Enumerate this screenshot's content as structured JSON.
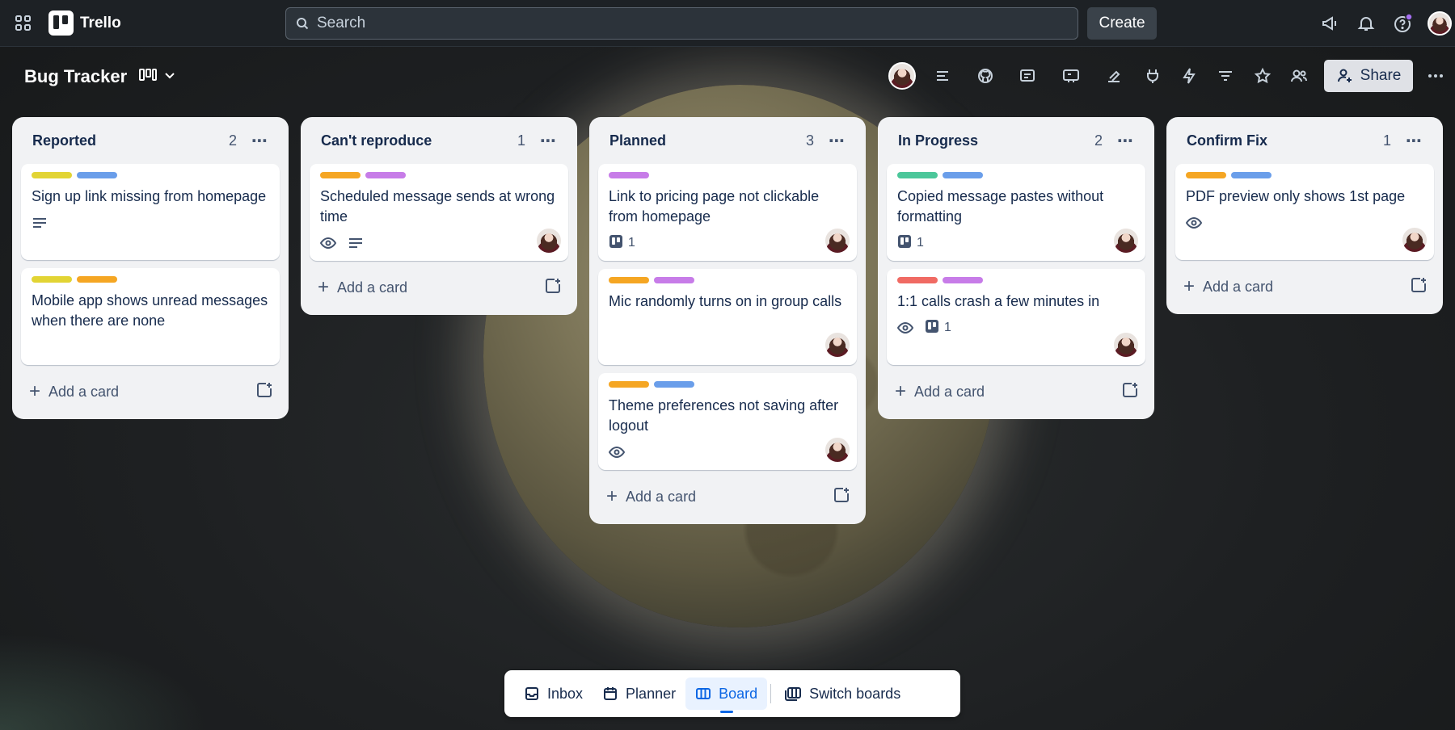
{
  "app": {
    "name": "Trello"
  },
  "search": {
    "placeholder": "Search"
  },
  "topbar": {
    "create_label": "Create"
  },
  "board": {
    "title": "Bug Tracker",
    "share_label": "Share"
  },
  "colors": {
    "yellow": "#e2d434",
    "blue": "#6a9eea",
    "orange": "#f5a623",
    "purple": "#c77ce8",
    "green": "#4bc79a",
    "red": "#f06a63"
  },
  "lists": [
    {
      "title": "Reported",
      "count": "2",
      "cards": [
        {
          "title": "Sign up link missing from homepage",
          "labels": [
            "yellow",
            "blue"
          ],
          "badges": [
            "description"
          ],
          "avatar": false
        },
        {
          "title": "Mobile app shows unread messages when there are none",
          "labels": [
            "yellow",
            "orange"
          ],
          "badges": [],
          "avatar": false
        }
      ]
    },
    {
      "title": "Can't reproduce",
      "count": "1",
      "cards": [
        {
          "title": "Scheduled message sends at wrong time",
          "labels": [
            "orange",
            "purple"
          ],
          "badges": [
            "watch",
            "description"
          ],
          "avatar": true
        }
      ]
    },
    {
      "title": "Planned",
      "count": "3",
      "cards": [
        {
          "title": "Link to pricing page not clickable from homepage",
          "labels": [
            "purple"
          ],
          "badges": [
            "trello:1"
          ],
          "avatar": true
        },
        {
          "title": "Mic randomly turns on in group calls",
          "labels": [
            "orange",
            "purple"
          ],
          "badges": [],
          "avatar": true
        },
        {
          "title": "Theme preferences not saving after logout",
          "labels": [
            "orange",
            "blue"
          ],
          "badges": [
            "watch"
          ],
          "avatar": true
        }
      ]
    },
    {
      "title": "In Progress",
      "count": "2",
      "cards": [
        {
          "title": "Copied message pastes without formatting",
          "labels": [
            "green",
            "blue"
          ],
          "badges": [
            "trello:1"
          ],
          "avatar": true
        },
        {
          "title": "1:1 calls crash a few minutes in",
          "labels": [
            "red",
            "purple"
          ],
          "badges": [
            "watch",
            "trello:1"
          ],
          "avatar": true
        }
      ]
    },
    {
      "title": "Confirm Fix",
      "count": "1",
      "cards": [
        {
          "title": "PDF preview only shows 1st page",
          "labels": [
            "orange",
            "blue"
          ],
          "badges": [
            "watch"
          ],
          "avatar": true
        }
      ]
    }
  ],
  "add_card_label": "Add a card",
  "bottom_nav": {
    "inbox": "Inbox",
    "planner": "Planner",
    "board": "Board",
    "switch": "Switch boards"
  }
}
